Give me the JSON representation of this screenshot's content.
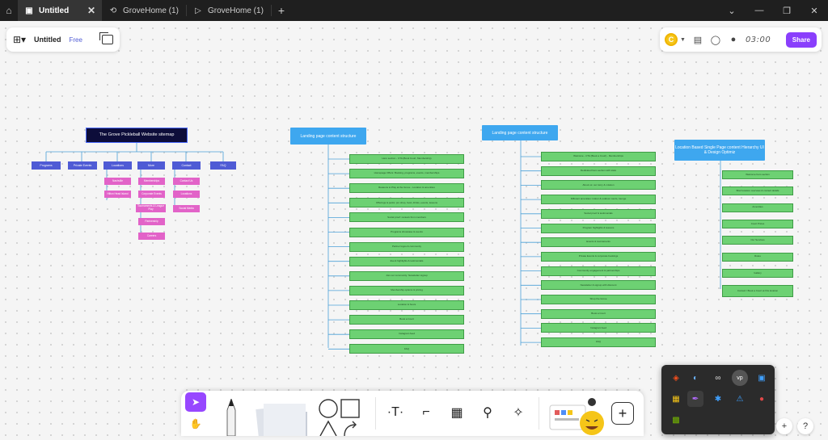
{
  "browser": {
    "tabs": [
      {
        "label": "Untitled",
        "active": true,
        "icon": "page-icon"
      },
      {
        "label": "GroveHome (1)",
        "active": false,
        "icon": "refresh-icon"
      },
      {
        "label": "GroveHome (1)",
        "active": false,
        "icon": "play-icon"
      }
    ]
  },
  "file": {
    "title": "Untitled",
    "plan": "Free"
  },
  "session": {
    "avatar_letter": "C",
    "timer": "03:00",
    "share_label": "Share"
  },
  "sitemap": {
    "title": "The Grove Pickleball Website sitemap",
    "top_level": [
      "Programs",
      "Private Events",
      "Locations",
      "More",
      "Contact",
      "FAQ"
    ],
    "locations_children": [
      "Nashville",
      "Hilton Head Island"
    ],
    "more_children": [
      "Memberships",
      "Corporate Events",
      "Tournaments & League Play",
      "Partnership",
      "Careers"
    ],
    "contact_children": [
      "Contact Us",
      "Locations",
      "Social Media"
    ]
  },
  "landing1": {
    "header": "Landing page content structure",
    "items": [
      "Hero section - CTA (Book Court, Membership)",
      "Homepage Offers: Booking, programs, events, memberships",
      "Reasons to Play at the Grove - Location & amenities",
      "Offerings & perks: pro shop, food, drinks, events, lessons",
      "Social proof: reviews from members",
      "Programs showcase & events",
      "Partner logos & community",
      "Event highlights & testimonials",
      "Join our community: Newsletter signup",
      "Membership options & pricing",
      "Location & hours",
      "Book a Court",
      "Instagram feed",
      "FAQ"
    ]
  },
  "landing2": {
    "header": "Landing page content structure",
    "items": [
      "Welcome - CTA (Book a Court) - Memberships",
      "Dedicated hero section with stats",
      "About us: our story & mission",
      "Different amenities: indoor & outdoor courts, lounge",
      "Social proof & testimonials",
      "Program highlights & lessons",
      "Events & tournaments",
      "Private Events & corporate bookings",
      "Community engagement & partnerships",
      "Newsletter & signup with discount",
      "Shop the Grove",
      "Book a Court",
      "Instagram feed",
      "FAQ"
    ]
  },
  "location": {
    "header": "Location Based Single Page content Hierarchy UI & Design Optimiz",
    "items": [
      "Welcome hero section",
      "Brief location overview & contact details",
      "Amenities",
      "Court Prices",
      "Our Services",
      "Rules",
      "Gallery",
      "Contact / Book a Court at this location"
    ]
  }
}
